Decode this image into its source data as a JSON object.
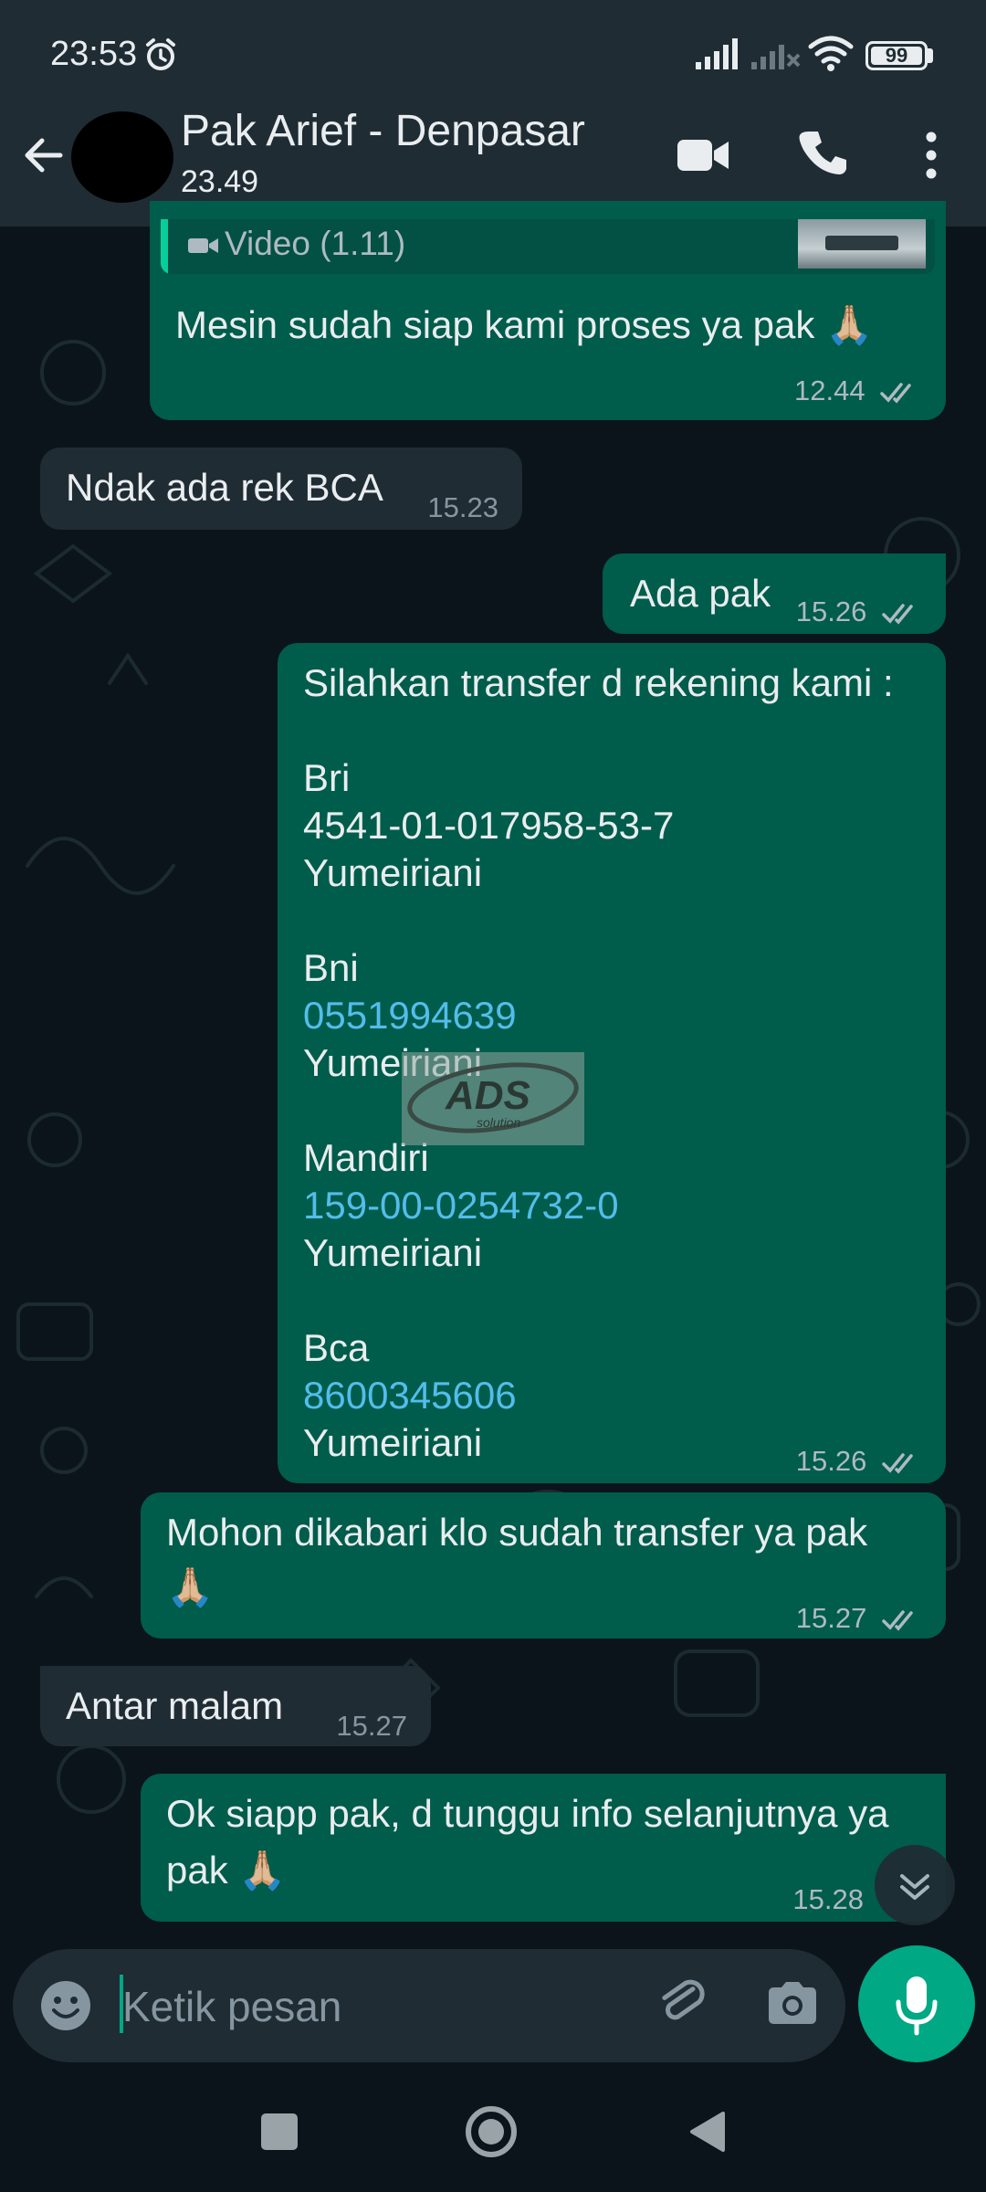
{
  "status_bar": {
    "time": "23:53",
    "battery": "99",
    "icons": [
      "alarm-icon",
      "signal-icon",
      "signal-no-service-icon",
      "wifi-icon",
      "battery-icon"
    ]
  },
  "header": {
    "contact_name": "Pak Arief - Denpasar",
    "last_seen": "23.49",
    "icons": [
      "back-arrow-icon",
      "video-call-icon",
      "phone-icon",
      "more-vertical-icon"
    ]
  },
  "messages": [
    {
      "direction": "outgoing",
      "quoted": "Video (1.11)",
      "text": "Mesin sudah siap kami proses ya pak 🙏🏼",
      "time": "12.44",
      "status": "read"
    },
    {
      "direction": "incoming",
      "text": "Ndak ada rek BCA",
      "time": "15.23"
    },
    {
      "direction": "outgoing",
      "text": "Ada pak",
      "time": "15.26",
      "status": "read"
    },
    {
      "direction": "outgoing",
      "lines": [
        "Silahkan transfer d rekening kami :",
        "",
        "Bri",
        "4541-01-017958-53-7",
        "Yumeiriani",
        "",
        "Bni",
        "0551994639",
        "Yumeiriani",
        "",
        "Mandiri",
        "159-00-0254732-0",
        "Yumeiriani",
        "",
        "Bca",
        "8600345606",
        "Yumeiriani"
      ],
      "time": "15.26",
      "status": "read"
    },
    {
      "direction": "outgoing",
      "line1": "Mohon dikabari klo sudah transfer ya pak",
      "line2": "🙏🏼",
      "time": "15.27",
      "status": "read"
    },
    {
      "direction": "incoming",
      "text": "Antar malam",
      "time": "15.27"
    },
    {
      "direction": "outgoing",
      "line1": "Ok siapp pak, d tunggu info selanjutnya ya",
      "line2": "pak 🙏🏼",
      "time": "15.28",
      "status": "read"
    }
  ],
  "watermark": {
    "text": "ADS",
    "subtext": "solution"
  },
  "composer": {
    "placeholder": "Ketik pesan",
    "value": ""
  },
  "colors": {
    "background": "#0b141a",
    "header": "#1f2c34",
    "outgoing_bubble": "#005c4b",
    "incoming_bubble": "#202c33",
    "accent": "#00a884",
    "link": "#53bdeb"
  }
}
